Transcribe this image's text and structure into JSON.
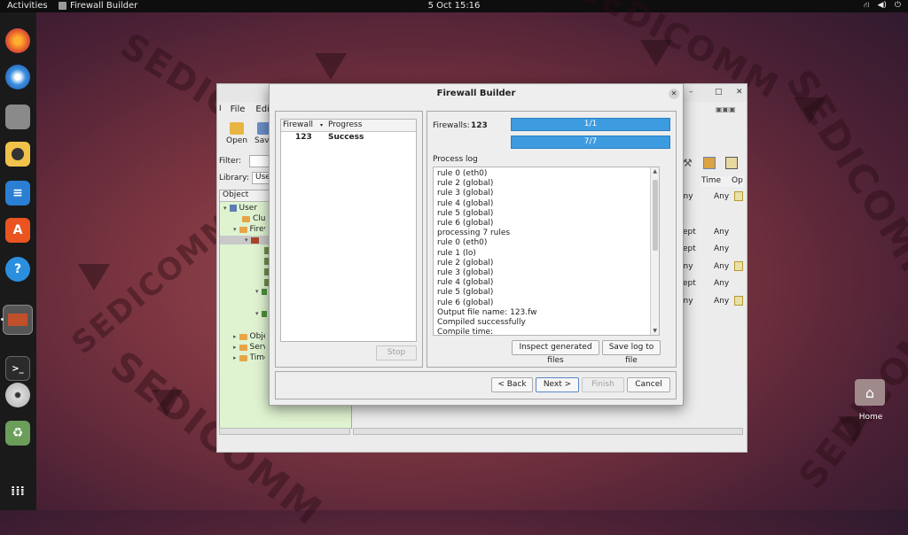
{
  "topbar": {
    "activities": "Activities",
    "app_name": "Firewall Builder",
    "datetime": "5 Oct  15:16",
    "icons": [
      "network-icon",
      "volume-icon",
      "power-icon"
    ]
  },
  "dock": {
    "items": [
      "firefox-icon",
      "thunderbird-icon",
      "files-icon",
      "rhythmbox-icon",
      "writer-icon",
      "app-center-icon",
      "help-icon",
      "firewall-builder-icon",
      "terminal-icon",
      "disc-icon",
      "trash-icon",
      "app-grid-icon"
    ]
  },
  "desktop": {
    "home_label": "Home",
    "watermark": "SEDICOMM"
  },
  "main_window": {
    "menu": [
      "File",
      "Edit"
    ],
    "toolbar": {
      "open": "Open",
      "save": "Save"
    },
    "filter_label": "Filter:",
    "library_label": "Library:",
    "library_value": "User",
    "tree_header": "Object",
    "tree": {
      "user": "User",
      "clusters": "Clusters",
      "firewalls": "Firewalls",
      "objects": "Objects",
      "services": "Services",
      "time": "Time"
    },
    "columns": {
      "time": "Time",
      "options": "Op"
    },
    "rules": [
      {
        "action": "eny",
        "time": "Any"
      },
      {
        "action": "cept",
        "time": "Any"
      },
      {
        "action": "cept",
        "time": "Any"
      },
      {
        "action": "eny",
        "time": "Any"
      },
      {
        "action": "cept",
        "time": "Any"
      },
      {
        "action": "eny",
        "time": "Any"
      }
    ]
  },
  "dialog": {
    "title": "Firewall Builder",
    "list_headers": {
      "firewall": "Firewall",
      "progress": "Progress"
    },
    "list_rows": [
      {
        "firewall": "123",
        "progress": "Success"
      }
    ],
    "stop_label": "Stop",
    "firewalls_label": "Firewalls:",
    "firewalls_value": "123",
    "progress_1": "1/1",
    "progress_2": "7/7",
    "process_log_label": "Process log",
    "log_lines": [
      "rule 0 (eth0)",
      "rule 2 (global)",
      "rule 3 (global)",
      "rule 4 (global)",
      "rule 5 (global)",
      "rule 6 (global)",
      "processing 7 rules",
      "rule 0 (eth0)",
      "rule 1 (lo)",
      "rule 2 (global)",
      "rule 3 (global)",
      "rule 4 (global)",
      "rule 5 (global)",
      "rule 6 (global)",
      "Output file name: 123.fw",
      "Compiled successfully",
      "Compile time:"
    ],
    "inspect_label": "Inspect generated files",
    "save_log_label": "Save log to file",
    "back_label": "< Back",
    "next_label": "Next >",
    "finish_label": "Finish",
    "cancel_label": "Cancel"
  }
}
